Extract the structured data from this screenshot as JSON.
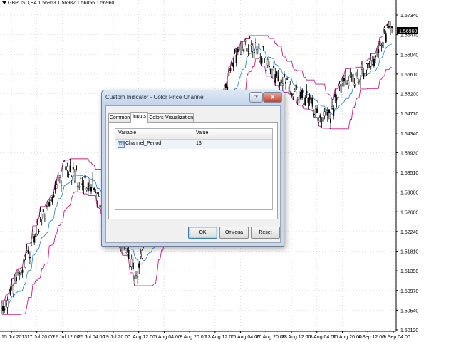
{
  "chart": {
    "symbol_line": "GBPUSD,H4  1.56963 1.56982 1.56856 1.56960",
    "price_labels": [
      "1.57340",
      "1.56470",
      "1.56040",
      "1.55610",
      "1.55200",
      "1.54770",
      "1.54340",
      "1.53930",
      "1.53510",
      "1.53080",
      "1.52660",
      "1.52240",
      "1.51810",
      "1.51390",
      "1.50970",
      "1.50540",
      "1.50120"
    ],
    "current_price": "1.56960",
    "time_labels": [
      "15 Jul 2013",
      "17 Jul 20:00",
      "22 Jul 12:00",
      "25 Jul 04:00",
      "29 Jul 20:00",
      "1 Aug 12:00",
      "6 Aug 04:00",
      "8 Aug 20:00",
      "13 Aug 12:00",
      "16 Aug 04:00",
      "20 Aug 20:00",
      "23 Aug 12:00",
      "28 Aug 04:00",
      "30 Aug 20:00",
      "4 Sep 12:00",
      "9 Sep 04:00"
    ],
    "colors": {
      "channel": "#c0208a",
      "midline": "#1e7fd8",
      "candles": "#000000",
      "grid": "#c8c8c8"
    }
  },
  "dialog": {
    "title": "Custom Indicator - Color Price Channel",
    "help_label": "?",
    "close_label": "X",
    "tabs": [
      {
        "label": "Common",
        "active": false
      },
      {
        "label": "Inputs",
        "active": true
      },
      {
        "label": "Colors",
        "active": false
      },
      {
        "label": "Visualization",
        "active": false
      }
    ],
    "grid": {
      "headers": {
        "variable": "Variable",
        "value": "Value"
      },
      "rows": [
        {
          "icon": "123",
          "variable": "Channel_Period",
          "value": "13"
        }
      ]
    },
    "buttons": {
      "ok": "OK",
      "cancel": "Отмена",
      "reset": "Reset"
    }
  }
}
